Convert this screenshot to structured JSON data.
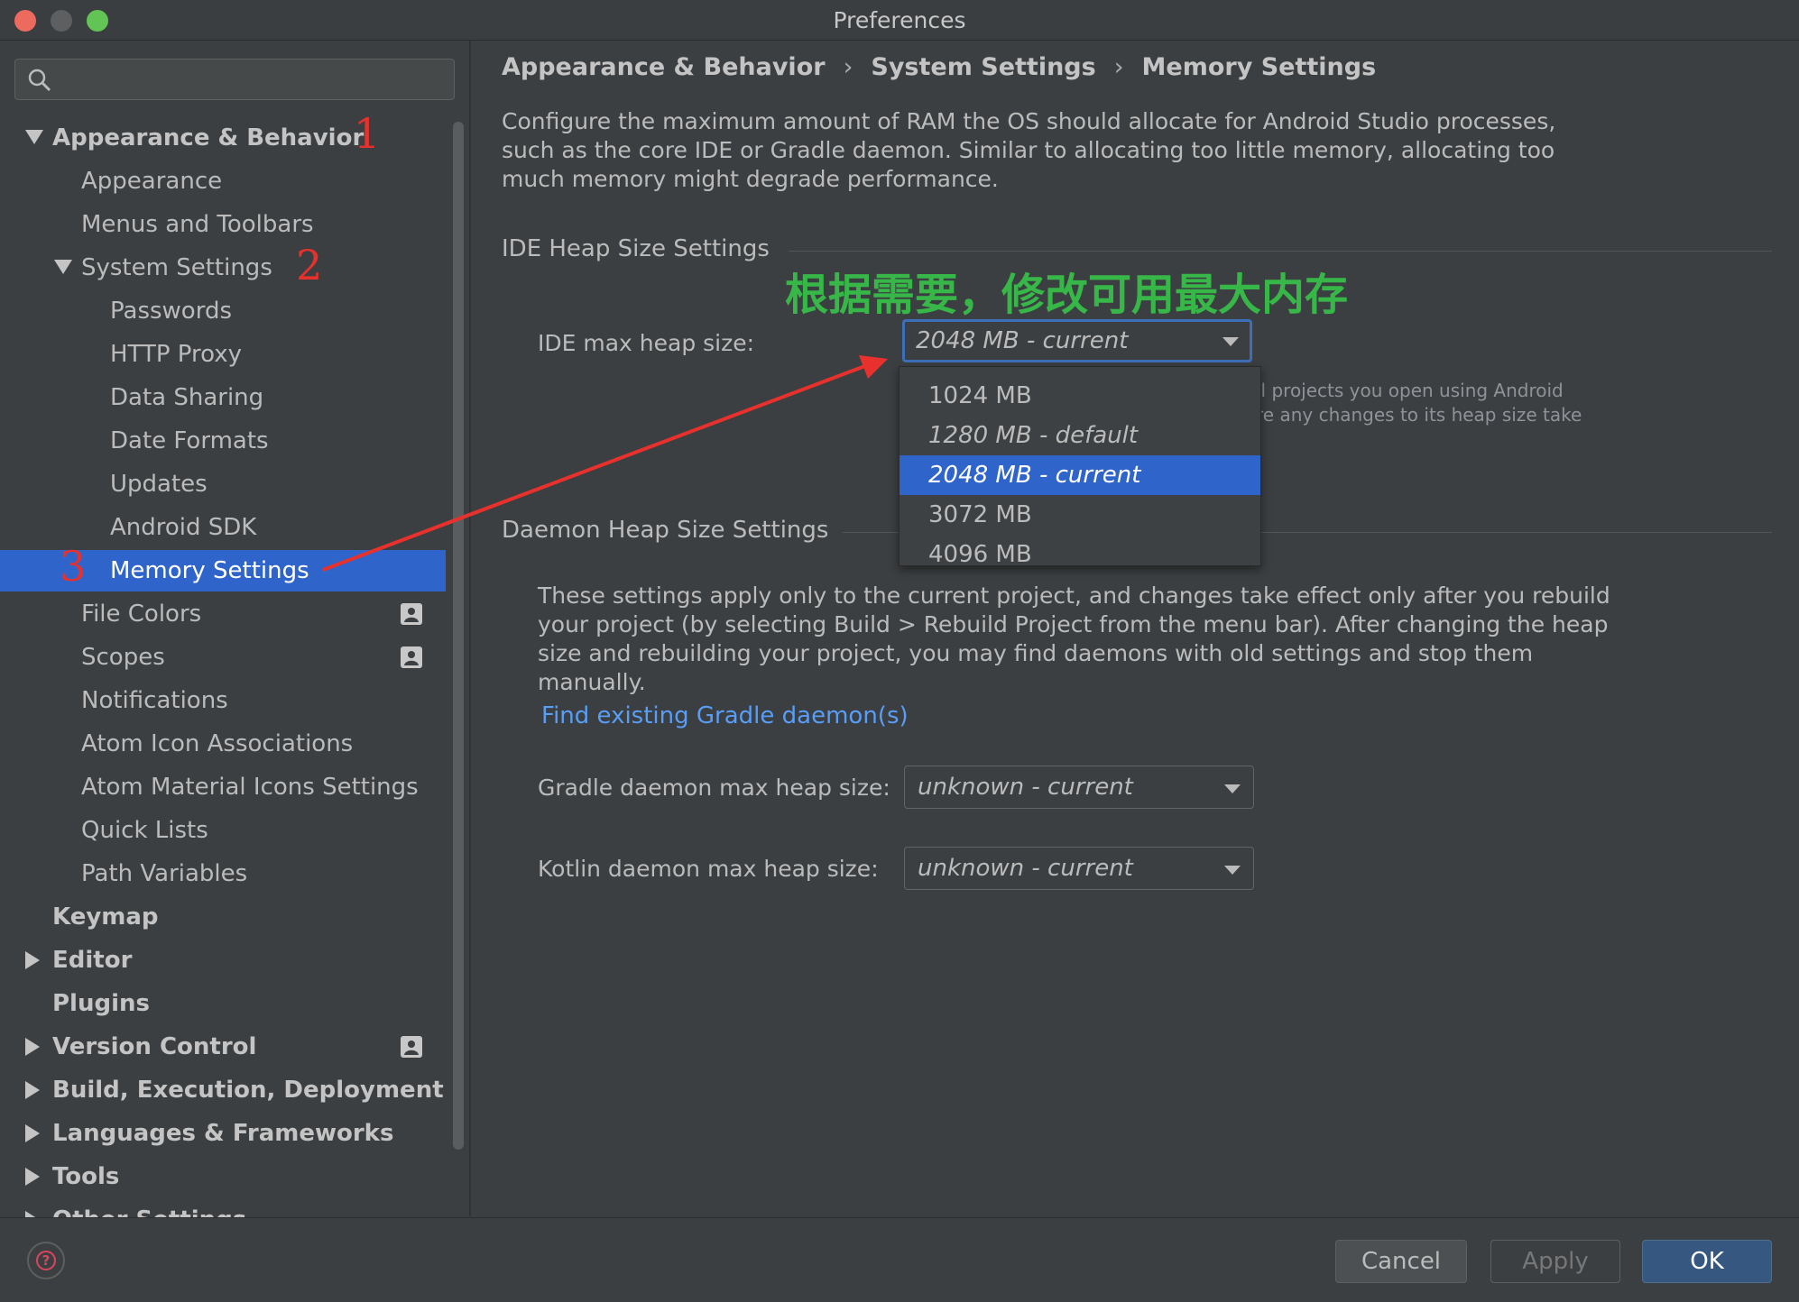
{
  "window": {
    "title": "Preferences"
  },
  "search": {
    "placeholder": ""
  },
  "sidebar": {
    "items": [
      {
        "label": "Appearance & Behavior",
        "level": 0,
        "bold": true,
        "expander": "down"
      },
      {
        "label": "Appearance",
        "level": 1
      },
      {
        "label": "Menus and Toolbars",
        "level": 1
      },
      {
        "label": "System Settings",
        "level": 1,
        "expander": "down"
      },
      {
        "label": "Passwords",
        "level": 2
      },
      {
        "label": "HTTP Proxy",
        "level": 2
      },
      {
        "label": "Data Sharing",
        "level": 2
      },
      {
        "label": "Date Formats",
        "level": 2
      },
      {
        "label": "Updates",
        "level": 2
      },
      {
        "label": "Android SDK",
        "level": 2
      },
      {
        "label": "Memory Settings",
        "level": 2,
        "selected": true
      },
      {
        "label": "File Colors",
        "level": 1,
        "badge": true
      },
      {
        "label": "Scopes",
        "level": 1,
        "badge": true
      },
      {
        "label": "Notifications",
        "level": 1
      },
      {
        "label": "Atom Icon Associations",
        "level": 1
      },
      {
        "label": "Atom Material Icons Settings",
        "level": 1
      },
      {
        "label": "Quick Lists",
        "level": 1
      },
      {
        "label": "Path Variables",
        "level": 1
      },
      {
        "label": "Keymap",
        "level": 0,
        "bold": true
      },
      {
        "label": "Editor",
        "level": 0,
        "bold": true,
        "expander": "right"
      },
      {
        "label": "Plugins",
        "level": 0,
        "bold": true
      },
      {
        "label": "Version Control",
        "level": 0,
        "bold": true,
        "expander": "right",
        "badge": true
      },
      {
        "label": "Build, Execution, Deployment",
        "level": 0,
        "bold": true,
        "expander": "right"
      },
      {
        "label": "Languages & Frameworks",
        "level": 0,
        "bold": true,
        "expander": "right"
      },
      {
        "label": "Tools",
        "level": 0,
        "bold": true,
        "expander": "right"
      },
      {
        "label": "Other Settings",
        "level": 0,
        "bold": true,
        "expander": "right"
      }
    ]
  },
  "annotations": {
    "n1": "1",
    "n2": "2",
    "n3": "3",
    "note": "根据需要，修改可用最大内存"
  },
  "breadcrumb": [
    "Appearance & Behavior",
    "System Settings",
    "Memory Settings"
  ],
  "breadcrumb_sep": "›",
  "description": "Configure the maximum amount of RAM the OS should allocate for Android Studio processes, such as the core IDE or Gradle daemon. Similar to allocating too little memory, allocating too much memory might degrade performance.",
  "ide_section": {
    "title": "IDE Heap Size Settings",
    "label": "IDE max heap size:",
    "value": "2048 MB - current",
    "hidden_line1": "ll projects you open using Android",
    "hidden_line2": "re any changes to its heap size take",
    "options": [
      "1024 MB",
      "1280 MB - default",
      "2048 MB - current",
      "3072 MB",
      "4096 MB"
    ]
  },
  "daemon_section": {
    "title": "Daemon Heap Size Settings",
    "description": "These settings apply only to the current project, and changes take effect only after you rebuild your project (by selecting Build > Rebuild Project from the menu bar). After changing the heap size and rebuilding your project, you may find daemons with old settings and stop them manually.",
    "link": "Find existing Gradle daemon(s)",
    "gradle_label": "Gradle daemon max heap size:",
    "gradle_value": "unknown - current",
    "kotlin_label": "Kotlin daemon max heap size:",
    "kotlin_value": "unknown - current"
  },
  "footer": {
    "help": "?",
    "cancel": "Cancel",
    "apply": "Apply",
    "ok": "OK"
  },
  "colors": {
    "accent": "#2f65ca",
    "link": "#589df6",
    "annotation_red": "#e8312c",
    "annotation_green": "#38b749"
  }
}
